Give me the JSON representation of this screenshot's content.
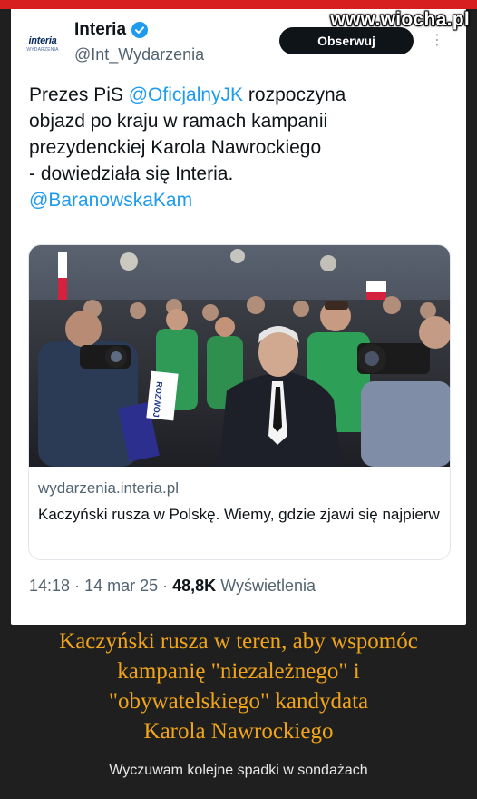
{
  "site": {
    "watermark": "www.wiocha.pl"
  },
  "tweet": {
    "avatar": {
      "logo_text": "interia",
      "logo_sub": "WYDARZENIA"
    },
    "account_name": "Interia",
    "handle": "@Int_Wydarzenia",
    "follow_label": "Obserwuj",
    "more_icon": "more-dots-icon",
    "text": {
      "line1_before": "Prezes PiS ",
      "line1_mention": "@OficjalnyJK",
      "line1_after": " rozpoczyna",
      "line2": "objazd po kraju w ramach kampanii",
      "line3": "prezydenckiej Karola Nawrockiego",
      "line4": "- dowiedziała się Interia.",
      "line5_mention": "@BaranowskaKam"
    },
    "link_card": {
      "domain": "wydarzenia.interia.pl",
      "title": "Kaczyński rusza w Polskę. Wiemy, gdzie zjawi się najpierw",
      "photo_sign_text": "ROZWÓJ"
    },
    "time": "14:18",
    "date": "14 mar 25",
    "views_count": "48,8K",
    "views_label": "Wyświetlenia"
  },
  "caption": {
    "line1": "Kaczyński rusza w teren, aby wspomóc",
    "line2": "kampanię \"niezależnego\" i",
    "line3": "\"obywatelskiego\" kandydata",
    "line4": "Karola Nawrockiego"
  },
  "comment": "Wyczuwam kolejne spadki w sondażach",
  "colors": {
    "mention": "#1d9bf0",
    "caption": "#f0a419",
    "background": "#1f1f1f",
    "verified": "#1d9bf0",
    "top_strip": "#d81f1f"
  }
}
